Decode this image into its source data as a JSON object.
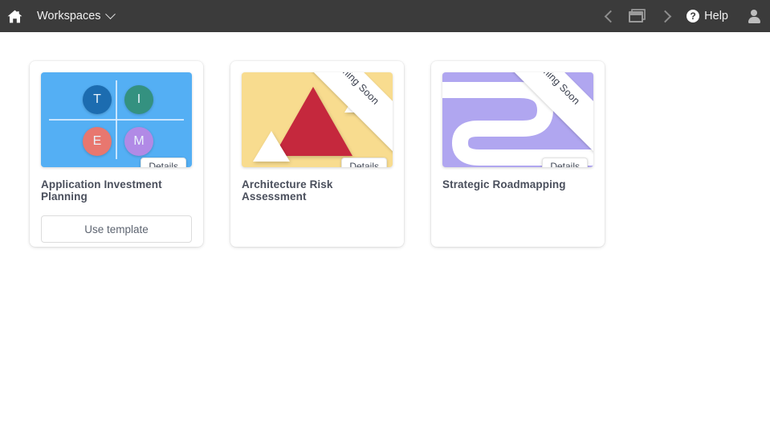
{
  "topbar": {
    "home_icon": "home-icon",
    "workspaces_label": "Workspaces",
    "workspaces_caret": "chevron-down-icon",
    "nav_back_icon": "chevron-left-icon",
    "windows_icon": "windows-panels-icon",
    "nav_forward_icon": "chevron-right-icon",
    "help_mark": "?",
    "help_label": "Help",
    "user_icon": "user-avatar-icon",
    "background_color": "#3b3b3b"
  },
  "cards": [
    {
      "title": "Application Investment Planning",
      "details_label": "Details",
      "action_label": "Use template",
      "has_action": true,
      "coming_soon": false,
      "ribbon_label": "",
      "thumbnail": {
        "kind": "quadrant",
        "background_color": "#54aff4",
        "bubbles": [
          {
            "letter": "T",
            "color": "#1c6cb0"
          },
          {
            "letter": "I",
            "color": "#349180"
          },
          {
            "letter": "E",
            "color": "#e8776f"
          },
          {
            "letter": "M",
            "color": "#b18ae6"
          }
        ]
      }
    },
    {
      "title": "Architecture Risk Assessment",
      "details_label": "Details",
      "action_label": "",
      "has_action": false,
      "coming_soon": true,
      "ribbon_label": "Coming Soon",
      "thumbnail": {
        "kind": "triangles",
        "background_color": "#f8dc8f",
        "primary_shape_color": "#c5283d",
        "secondary_shape_color": "#ffffff"
      }
    },
    {
      "title": "Strategic Roadmapping",
      "details_label": "Details",
      "action_label": "",
      "has_action": false,
      "coming_soon": true,
      "ribbon_label": "Coming Soon",
      "thumbnail": {
        "kind": "roadmap",
        "background_color": "#b0a6f0",
        "primary_shape_color": "#ffffff"
      }
    }
  ]
}
